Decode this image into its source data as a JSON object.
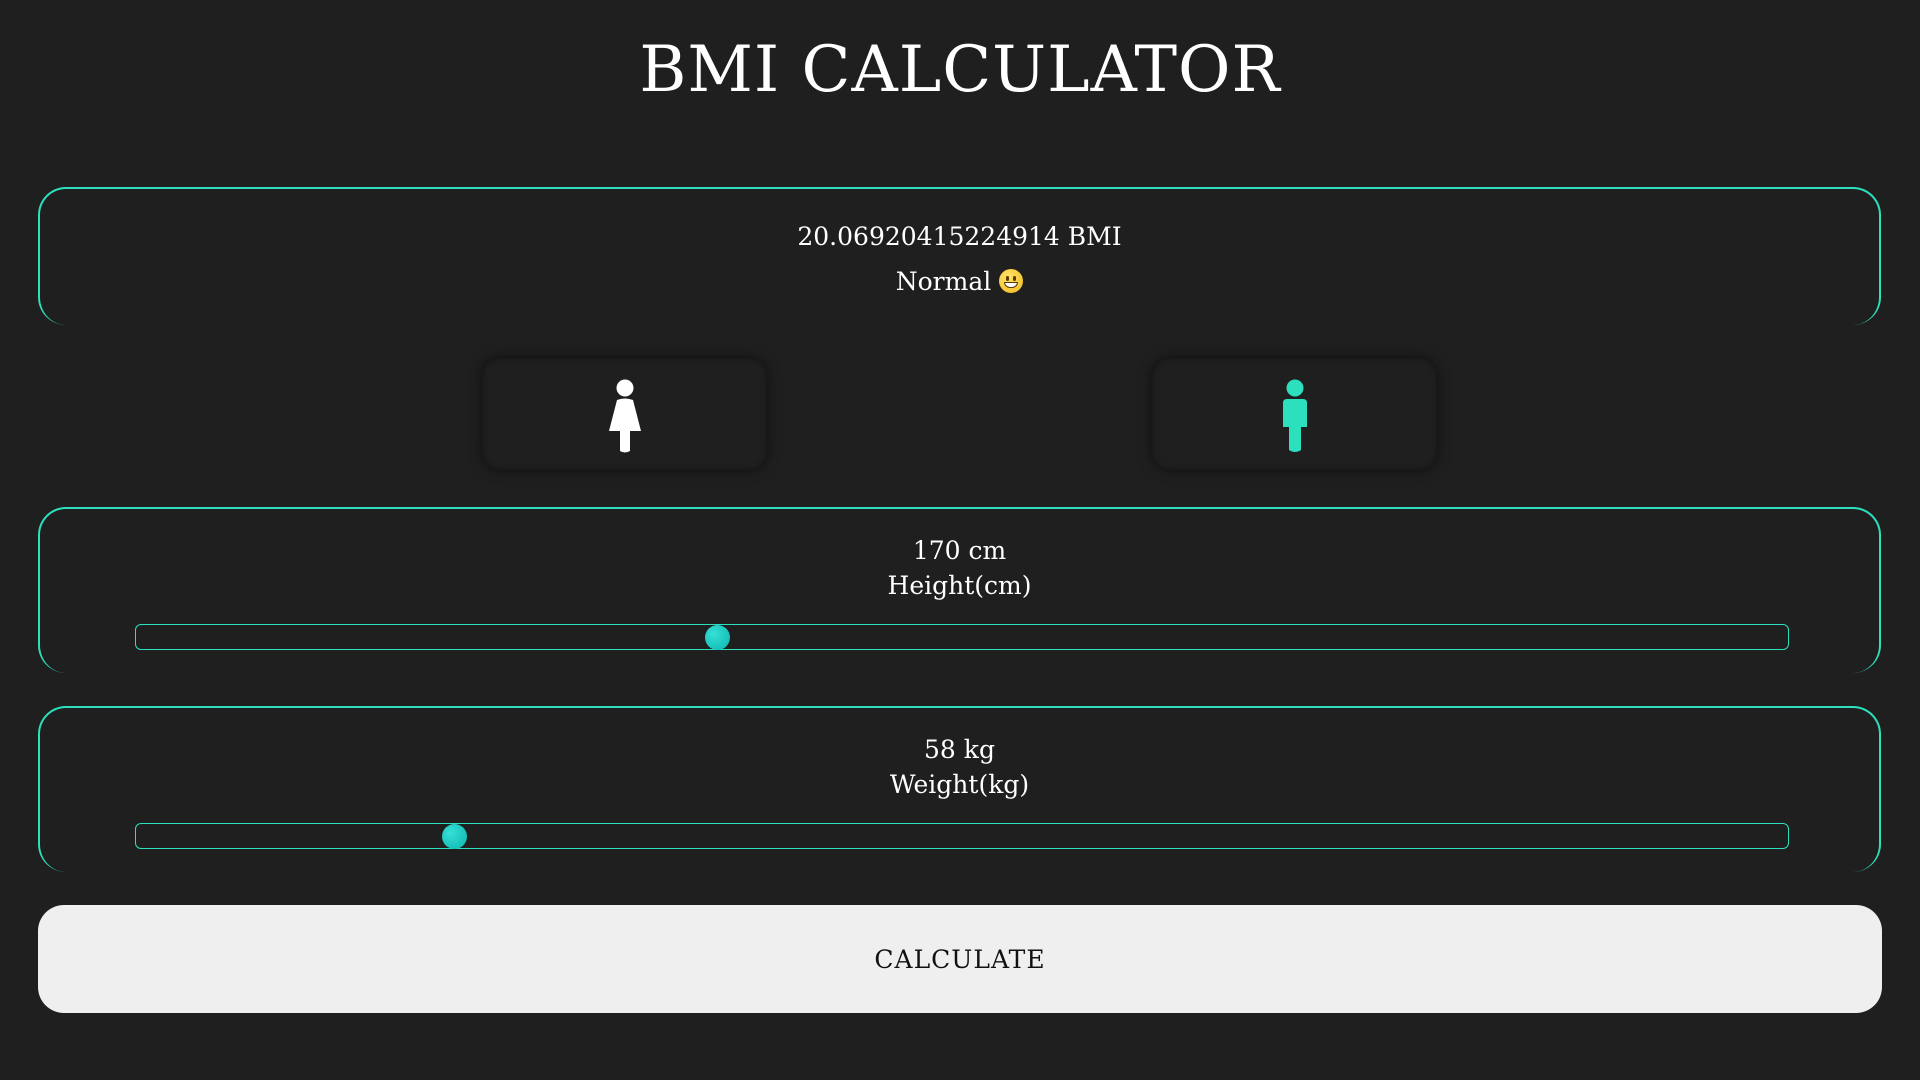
{
  "title": "BMI CALCULATOR",
  "result": {
    "bmi_text": "20.06920415224914 BMI",
    "status_text": "Normal",
    "status_icon": "grinning-face-emoji"
  },
  "gender": {
    "options": [
      {
        "id": "female",
        "icon": "female-icon",
        "color": "#ffffff",
        "selected": false
      },
      {
        "id": "male",
        "icon": "male-icon",
        "color": "#2de0bd",
        "selected": true
      }
    ]
  },
  "height": {
    "value_text": "170 cm",
    "label": "Height(cm)",
    "fraction": 0.352
  },
  "weight": {
    "value_text": "58 kg",
    "label": "Weight(kg)",
    "fraction": 0.193
  },
  "calculate_label": "CALCULATE",
  "colors": {
    "background": "#1f1f1f",
    "accent": "#2de0bd",
    "thumb": "#13c2bd",
    "button_bg": "#efefef"
  }
}
